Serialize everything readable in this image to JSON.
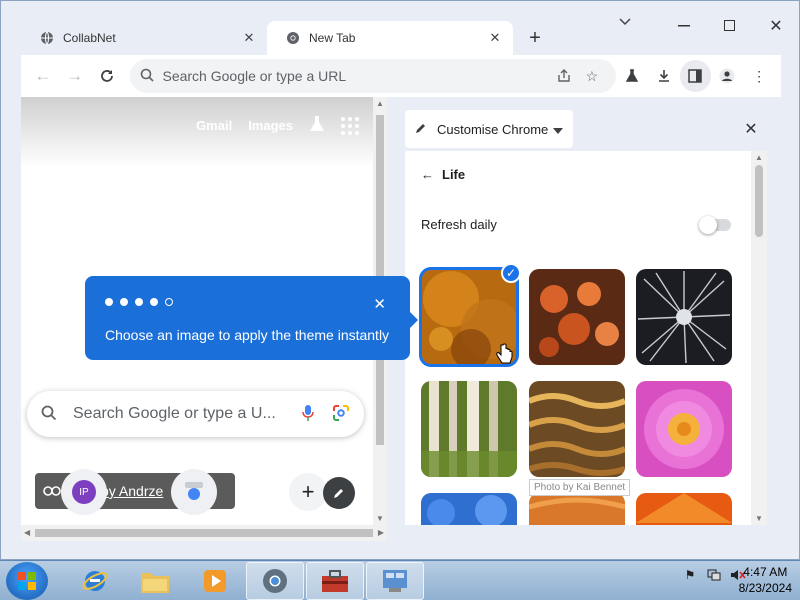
{
  "browser": {
    "tabs": [
      {
        "title": "CollabNet",
        "favicon": "globe-icon"
      },
      {
        "title": "New Tab",
        "favicon": "chrome-icon"
      }
    ],
    "omnibox_placeholder": "Search Google or type a URL"
  },
  "page": {
    "links": [
      "Gmail",
      "Images"
    ],
    "search_placeholder": "Search Google or type a U...",
    "attribution": "by Andrze",
    "attribution_suffix": "n",
    "avatar_initials": "IP"
  },
  "callout": {
    "text": "Choose an image to apply the theme instantly",
    "step_count": 5,
    "current_step": 4
  },
  "side_panel": {
    "title": "Customise Chrome",
    "back_label": "Life",
    "refresh_label": "Refresh daily",
    "refresh_on": false,
    "tooltip": "Photo by Kai Bennet",
    "themes": [
      {
        "name": "autumn-leaves",
        "selected": true
      },
      {
        "name": "orange-coral",
        "selected": false
      },
      {
        "name": "dark-burst",
        "selected": false
      },
      {
        "name": "birch-trees",
        "selected": false
      },
      {
        "name": "golden-water",
        "selected": false
      },
      {
        "name": "pink-dahlia",
        "selected": false
      },
      {
        "name": "blue-ice",
        "selected": false
      },
      {
        "name": "orange-dunes",
        "selected": false
      },
      {
        "name": "orange-petals",
        "selected": false
      }
    ]
  },
  "taskbar": {
    "time": "4:47 AM",
    "date": "8/23/2024"
  },
  "colors": {
    "accent": "#1a73e8",
    "callout": "#1b6fd9"
  }
}
